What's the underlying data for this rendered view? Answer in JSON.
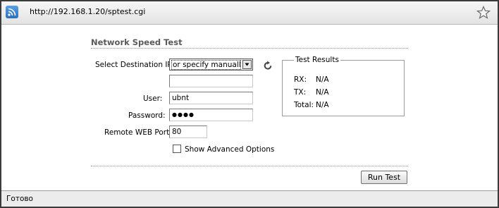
{
  "browser": {
    "url": "http://192.168.1.20/sptest.cgi",
    "status": "Готово"
  },
  "form": {
    "title": "Network Speed Test",
    "destination_label": "Select Destination IP:",
    "destination_selected": "or specify manually",
    "manual_ip_value": "",
    "user_label": "User:",
    "user_value": "ubnt",
    "password_label": "Password:",
    "password_masked": "●●●●",
    "port_label": "Remote WEB Port:",
    "port_value": "80",
    "advanced_label": "Show Advanced Options",
    "advanced_checked": false,
    "run_button": "Run Test"
  },
  "results": {
    "legend": "Test Results",
    "rows": [
      {
        "label": "RX:",
        "value": "N/A"
      },
      {
        "label": "TX:",
        "value": "N/A"
      },
      {
        "label": "Total:",
        "value": "N/A"
      }
    ]
  },
  "icons": {
    "feed": "rss-icon",
    "bookmark": "star-icon",
    "refresh": "refresh-icon",
    "dropdown": "chevron-down-icon"
  }
}
